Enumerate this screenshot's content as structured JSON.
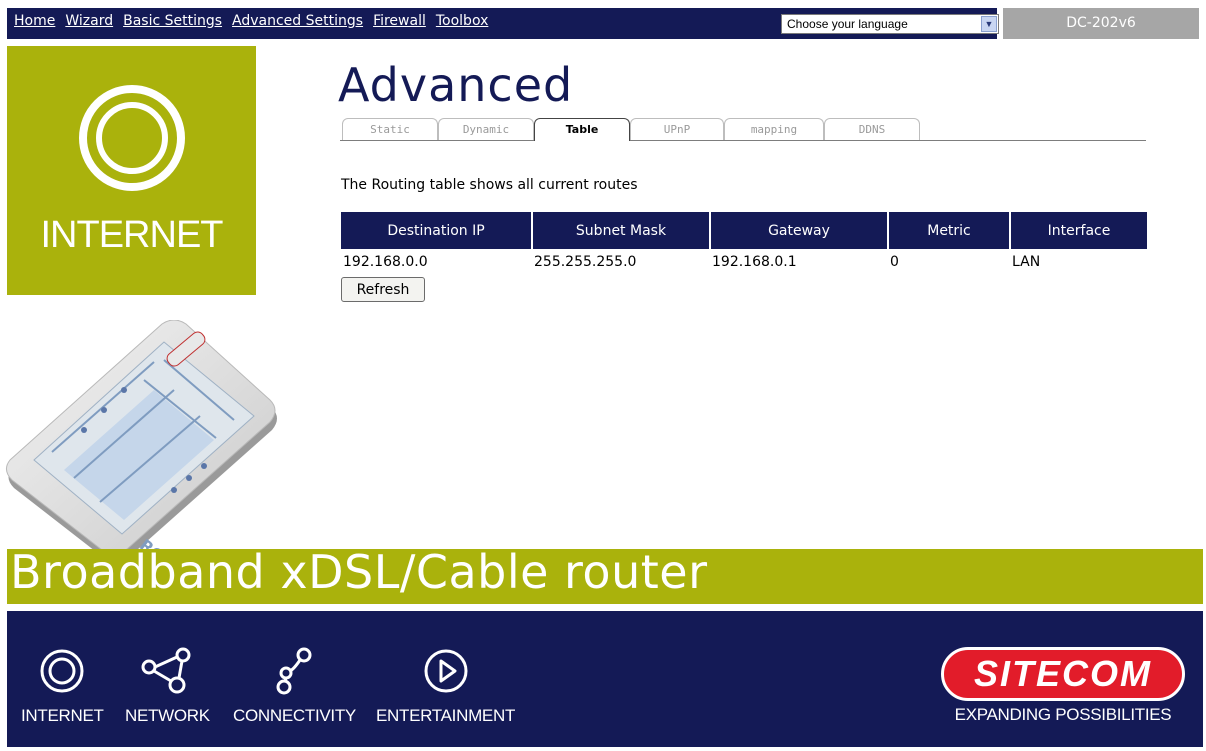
{
  "nav": {
    "items": [
      "Home",
      "Wizard",
      "Basic Settings",
      "Advanced Settings",
      "Firewall",
      "Toolbox"
    ],
    "language_selected": "Choose your language",
    "model": "DC-202v6"
  },
  "logo": {
    "label": "INTERNET"
  },
  "page": {
    "title": "Advanced",
    "tabs": [
      "Static",
      "Dynamic",
      "Table",
      "UPnP",
      "mapping",
      "DDNS"
    ],
    "active_tab": "Table",
    "description": "The Routing table shows all current routes"
  },
  "table": {
    "headers": [
      "Destination IP",
      "Subnet Mask",
      "Gateway",
      "Metric",
      "Interface"
    ],
    "rows": [
      [
        "192.168.0.0",
        "255.255.255.0",
        "192.168.0.1",
        "0",
        "LAN"
      ]
    ]
  },
  "refresh_label": "Refresh",
  "banner": {
    "text": "Broadband xDSL/Cable router"
  },
  "footer": {
    "items": [
      "INTERNET",
      "NETWORK",
      "CONNECTIVITY",
      "ENTERTAINMENT"
    ],
    "brand": "SITECOM",
    "tagline": "EXPANDING POSSIBILITIES"
  },
  "colors": {
    "navy": "#141a56",
    "olive": "#aab20c",
    "model_gray": "#a6a6a6",
    "brand_red": "#e21c2a"
  },
  "icons": {
    "logo": "concentric-ring-icon",
    "language_dropdown": "chevron-down-icon",
    "footer": [
      "internet-icon",
      "network-icon",
      "connectivity-icon",
      "entertainment-icon"
    ]
  }
}
